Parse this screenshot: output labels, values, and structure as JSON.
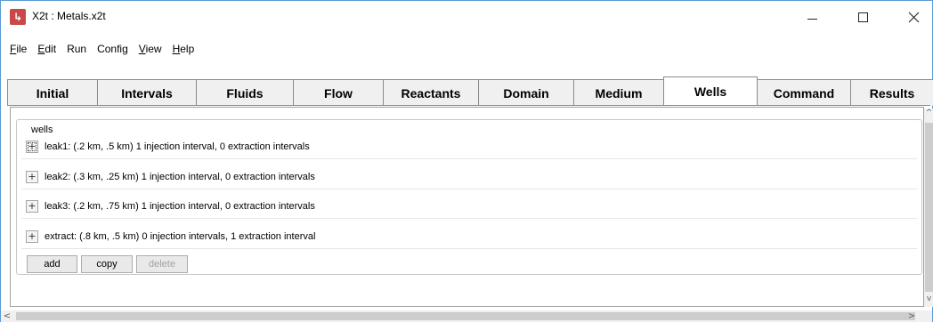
{
  "window": {
    "title": "X2t : Metals.x2t",
    "icon": "app-logo-icon",
    "controls": {
      "minimize": "minimize-icon",
      "maximize": "maximize-icon",
      "close": "close-icon"
    }
  },
  "menu": [
    {
      "label": "File",
      "mnemonic": "F",
      "rest": "ile"
    },
    {
      "label": "Edit",
      "mnemonic": "E",
      "rest": "dit"
    },
    {
      "label": "Run",
      "mnemonic": "",
      "rest": "Run"
    },
    {
      "label": "Config",
      "mnemonic": "",
      "rest": "Config"
    },
    {
      "label": "View",
      "mnemonic": "V",
      "rest": "iew"
    },
    {
      "label": "Help",
      "mnemonic": "H",
      "rest": "elp"
    }
  ],
  "tabs": [
    {
      "label": "Initial",
      "active": false
    },
    {
      "label": "Intervals",
      "active": false
    },
    {
      "label": "Fluids",
      "active": false
    },
    {
      "label": "Flow",
      "active": false
    },
    {
      "label": "Reactants",
      "active": false
    },
    {
      "label": "Domain",
      "active": false
    },
    {
      "label": "Medium",
      "active": false
    },
    {
      "label": "Wells",
      "active": true
    },
    {
      "label": "Command",
      "active": false
    },
    {
      "label": "Results",
      "active": false
    }
  ],
  "wells_group": {
    "legend": "wells",
    "rows": [
      {
        "expand": "+",
        "text": "leak1: (.2 km, .5 km) 1 injection interval, 0 extraction intervals"
      },
      {
        "expand": "+",
        "text": "leak2: (.3 km, .25 km) 1 injection interval, 0 extraction intervals"
      },
      {
        "expand": "+",
        "text": "leak3: (.2 km, .75 km) 1 injection interval, 0 extraction intervals"
      },
      {
        "expand": "+",
        "text": "extract: (.8 km, .5 km) 0 injection intervals, 1 extraction interval"
      }
    ],
    "buttons": {
      "add": "add",
      "copy": "copy",
      "delete": "delete"
    }
  },
  "scrollbars": {
    "v_up": "^",
    "v_down": "v",
    "h_left": "<",
    "h_right": ">"
  }
}
